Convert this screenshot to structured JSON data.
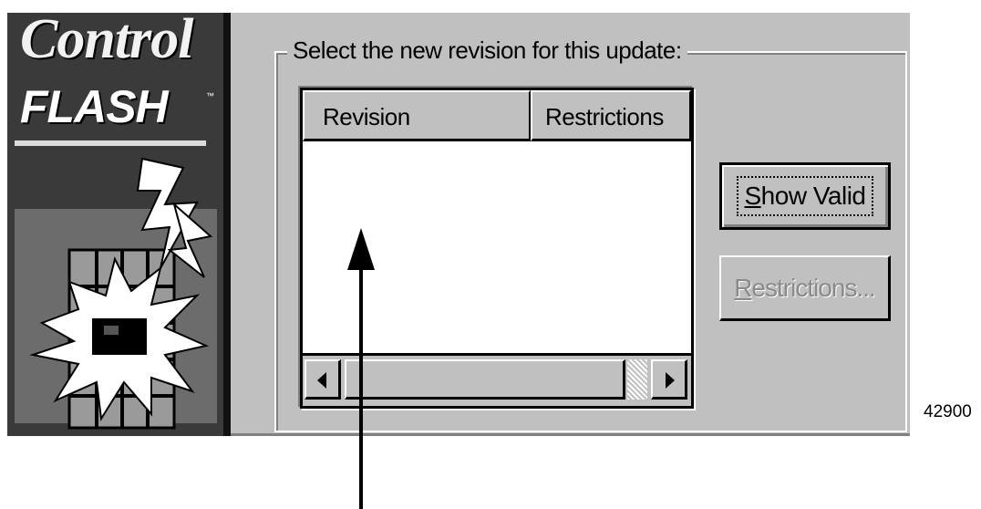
{
  "banner": {
    "title_line1": "Control",
    "title_line2": "FLASH",
    "trademark": "™"
  },
  "dialog": {
    "group_caption": "Select the new revision for this update:",
    "list": {
      "columns": [
        "Revision",
        "Restrictions"
      ],
      "rows": []
    },
    "buttons": {
      "show_valid": {
        "mnemonic": "S",
        "rest": "how Valid",
        "enabled": true,
        "focused": true
      },
      "restrictions": {
        "mnemonic": "R",
        "rest": "estrictions...",
        "enabled": false
      }
    }
  },
  "figure_number": "42900"
}
